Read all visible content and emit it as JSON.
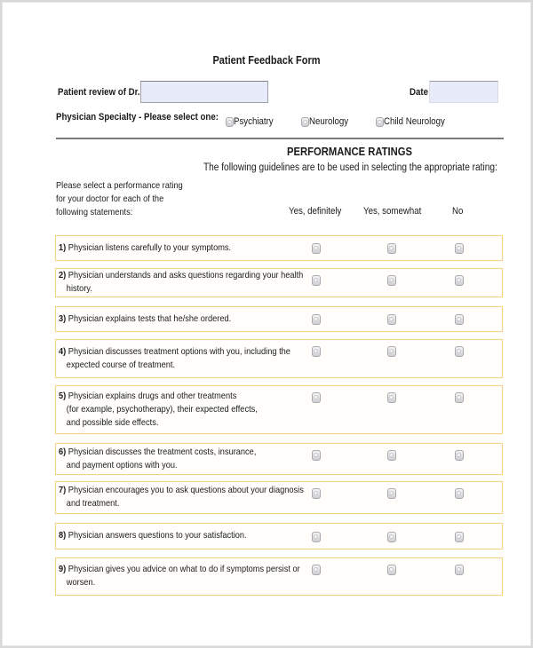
{
  "form": {
    "title": "Patient Feedback Form",
    "doctor_label": "Patient review of Dr.",
    "doctor_value": "",
    "date_label": "Date",
    "date_value": "",
    "specialty_label": "Physician Specialty - Please select one:",
    "specialty_options": [
      {
        "label": "Psychiatry",
        "selected": false
      },
      {
        "label": "Neurology",
        "selected": false
      },
      {
        "label": "Child Neurology",
        "selected": false
      }
    ]
  },
  "ratings": {
    "heading": "PERFORMANCE RATINGS",
    "guidelines": "The following guidelines are to be used in selecting the appropriate rating:",
    "instructions": [
      "Please select a performance rating",
      "for your doctor for each of the",
      "following statements:"
    ],
    "columns": [
      "Yes, definitely",
      "Yes, somewhat",
      "No"
    ]
  },
  "questions": [
    {
      "num": "1)",
      "lines": [
        "Physician listens carefully to your symptoms."
      ]
    },
    {
      "num": "2)",
      "lines": [
        "Physician understands and asks questions regarding your health",
        "history."
      ]
    },
    {
      "num": "3)",
      "lines": [
        "Physician explains tests that he/she ordered."
      ]
    },
    {
      "num": "4)",
      "lines": [
        "Physician discusses treatment options with you, including the",
        "expected course of treatment."
      ]
    },
    {
      "num": "5)",
      "lines": [
        "Physician explains drugs and other treatments",
        "(for example, psychotherapy), their expected effects,",
        "and possible side effects."
      ]
    },
    {
      "num": "6)",
      "lines": [
        "Physician discusses the treatment costs, insurance,",
        "and payment options with you."
      ]
    },
    {
      "num": "7)",
      "lines": [
        "Physician encourages you to ask questions about your diagnosis",
        "and treatment."
      ]
    },
    {
      "num": "8)",
      "lines": [
        "Physician answers questions to your satisfaction."
      ]
    },
    {
      "num": "9)",
      "lines": [
        "Physician gives you advice on what to do if symptoms persist or",
        "worsen."
      ]
    }
  ]
}
